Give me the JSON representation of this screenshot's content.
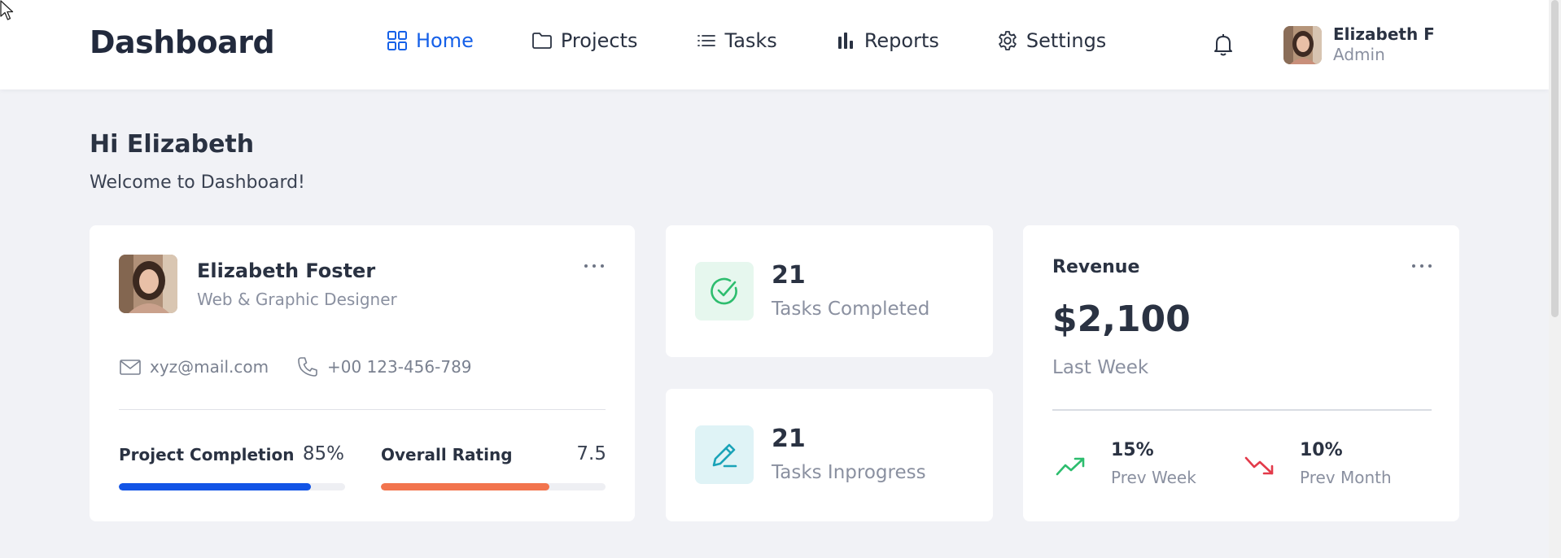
{
  "header": {
    "brand": "Dashboard",
    "nav": [
      {
        "label": "Home",
        "icon": "grid-icon",
        "active": true
      },
      {
        "label": "Projects",
        "icon": "folder-icon",
        "active": false
      },
      {
        "label": "Tasks",
        "icon": "list-icon",
        "active": false
      },
      {
        "label": "Reports",
        "icon": "bar-chart-icon",
        "active": false
      },
      {
        "label": "Settings",
        "icon": "gear-icon",
        "active": false
      }
    ],
    "notifications_icon": "bell-icon",
    "user": {
      "name": "Elizabeth F",
      "role": "Admin"
    }
  },
  "greeting": {
    "title": "Hi Elizabeth",
    "subtitle": "Welcome to Dashboard!"
  },
  "profile": {
    "name": "Elizabeth Foster",
    "title": "Web & Graphic Designer",
    "email": "xyz@mail.com",
    "phone": "+00 123-456-789",
    "metrics": [
      {
        "label": "Project Completion",
        "value": "85%",
        "fill_fraction": 0.85,
        "color": "#1254e6"
      },
      {
        "label": "Overall Rating",
        "value": "7.5",
        "fill_fraction": 0.75,
        "color": "#f2744d"
      }
    ]
  },
  "tasks": [
    {
      "count": "21",
      "label": "Tasks Completed",
      "icon": "check-circle-icon",
      "icon_color": "#2dbd6e",
      "icon_bg": "#e6f7ee"
    },
    {
      "count": "21",
      "label": "Tasks Inprogress",
      "icon": "pen-icon",
      "icon_color": "#1aa3b8",
      "icon_bg": "#dff3f6"
    }
  ],
  "revenue": {
    "title": "Revenue",
    "amount": "$2,100",
    "period": "Last Week",
    "stats": [
      {
        "value": "15%",
        "label": "Prev Week",
        "trend": "up",
        "icon": "trend-up-icon",
        "color": "#2dbd6e"
      },
      {
        "value": "10%",
        "label": "Prev Month",
        "trend": "down",
        "icon": "trend-down-icon",
        "color": "#e33a4a"
      }
    ]
  }
}
